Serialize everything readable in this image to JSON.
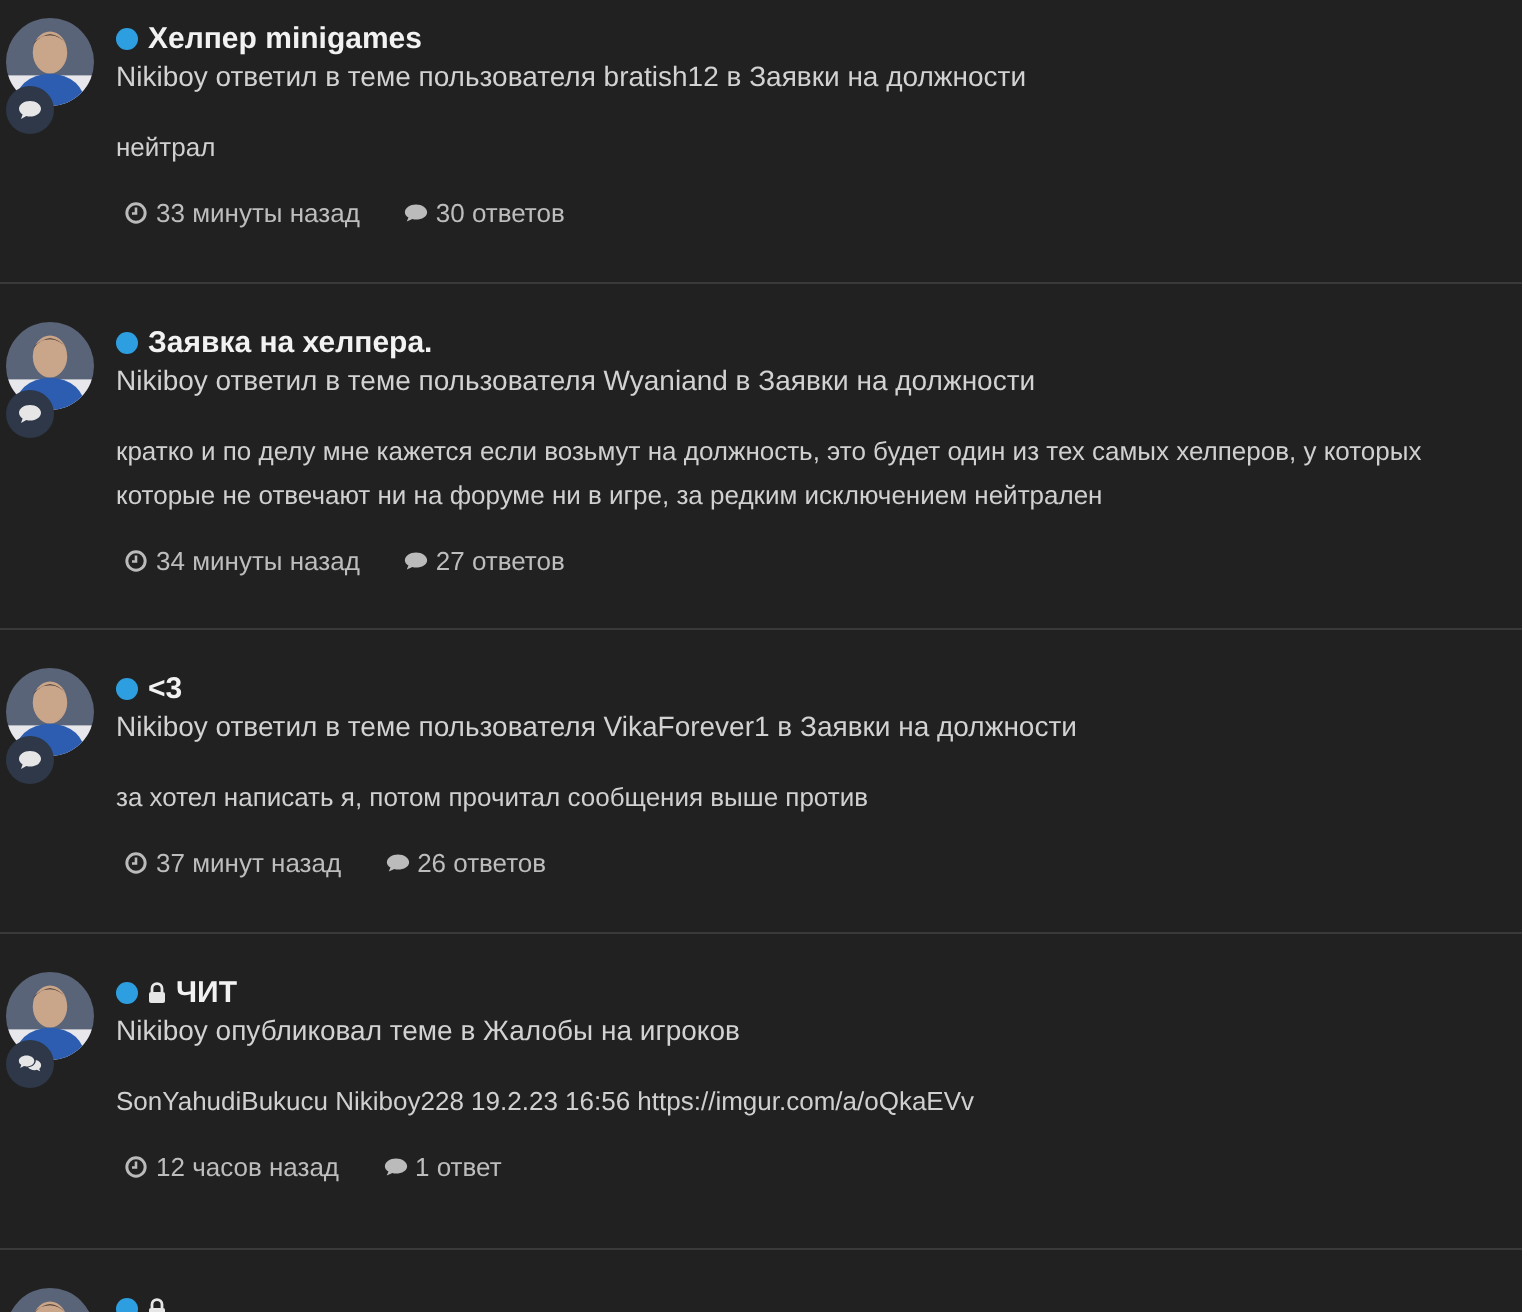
{
  "items": [
    {
      "kind": "reply",
      "locked": false,
      "title": "Хелпер minigames",
      "byline": "Nikiboy ответил в теме пользователя bratish12 в Заявки на должности",
      "body": [
        "нейтрал"
      ],
      "time": "33 минуты назад",
      "replies": "30 ответов"
    },
    {
      "kind": "reply",
      "locked": false,
      "title": "Заявка на хелпера.",
      "byline": "Nikiboy ответил в теме пользователя Wyaniand в Заявки на должности",
      "body": [
        "кратко и по делу мне кажется если возьмут на должность, это будет один из тех самых хелперов, у которых",
        "которые не отвечают ни на форуме ни в игре, за редким исключением нейтрален"
      ],
      "time": "34 минуты назад",
      "replies": "27 ответов"
    },
    {
      "kind": "reply",
      "locked": false,
      "title": "<3",
      "byline": "Nikiboy ответил в теме пользователя VikaForever1 в Заявки на должности",
      "body": [
        "за хотел написать я, потом прочитал сообщения выше против"
      ],
      "time": "37 минут назад",
      "replies": "26 ответов"
    },
    {
      "kind": "topic",
      "locked": true,
      "title": "ЧИТ",
      "byline": "Nikiboy опубликовал теме в Жалобы на игроков",
      "body": [
        "SonYahudiBukucu Nikiboy228 19.2.23 16:56 https://imgur.com/a/oQkaEVv"
      ],
      "time": "12 часов назад",
      "replies": "1 ответ"
    },
    {
      "locked": true
    }
  ]
}
